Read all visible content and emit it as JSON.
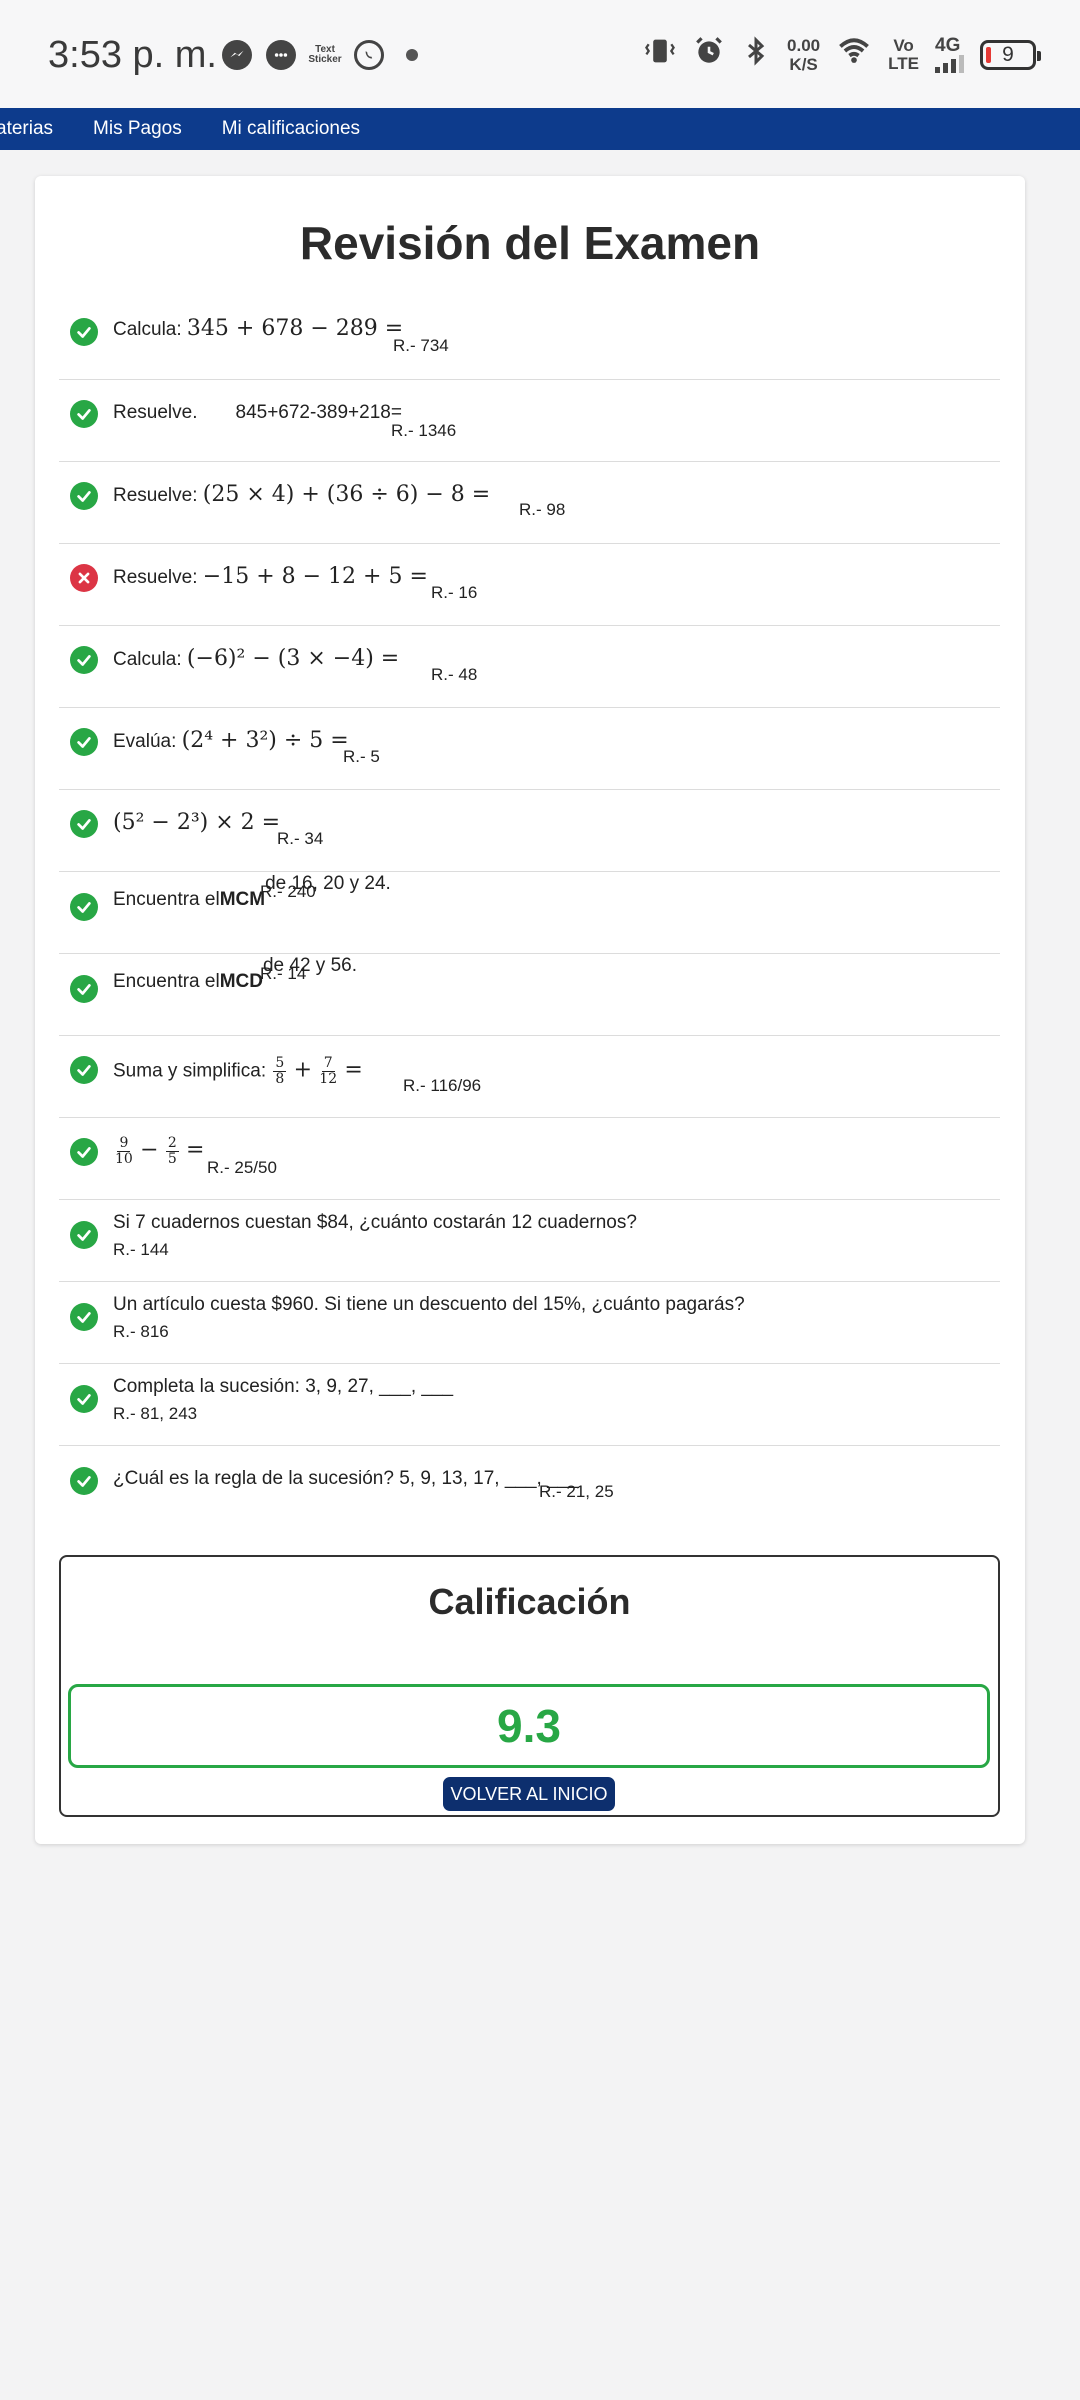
{
  "status_bar": {
    "time": "3:53 p. m.",
    "app_icons": [
      "messenger-icon",
      "chat-icon",
      "text-sticker-icon",
      "whatsapp-icon"
    ],
    "sticker_label": "Text\nSticker",
    "speed_value": "0.00",
    "speed_unit": "K/S",
    "volte_top": "Vo",
    "volte_bottom": "LTE",
    "network": "4G",
    "battery": "9"
  },
  "nav": {
    "items": [
      "aterias",
      "Mis Pagos",
      "Mi calificaciones"
    ]
  },
  "page": {
    "title": "Revisión del Examen"
  },
  "questions": [
    {
      "status": "correct",
      "prefix": "Calcula: ",
      "math": "345 + 678 − 289 =",
      "answer": "R.- 734"
    },
    {
      "status": "correct",
      "prefix": "Resuelve.",
      "math": "845+672-389+218=",
      "answer": "R.- 1346"
    },
    {
      "status": "correct",
      "prefix": "Resuelve: ",
      "math": "(25 × 4) + (36 ÷ 6) − 8 =",
      "answer": "R.- 98"
    },
    {
      "status": "incorrect",
      "prefix": "Resuelve: ",
      "math": "−15 + 8 − 12 + 5 =",
      "answer": "R.- 16"
    },
    {
      "status": "correct",
      "prefix": "Calcula: ",
      "math": "(−6)² − (3 × −4) =",
      "answer": "R.- 48"
    },
    {
      "status": "correct",
      "prefix": "Evalúa: ",
      "math": "(2⁴ + 3²) ÷ 5 =",
      "answer": "R.- 5"
    },
    {
      "status": "correct",
      "prefix": "",
      "math": "(5² − 2³) × 2 =",
      "answer": "R.- 34"
    },
    {
      "status": "correct",
      "prefix": "Encuentra el",
      "bold": "MCM",
      "suffix": "de 16, 20 y 24.",
      "answer": "R.- 240"
    },
    {
      "status": "correct",
      "prefix": "Encuentra el",
      "bold": "MCD",
      "suffix": "de 42 y 56.",
      "answer": "R.- 14"
    },
    {
      "status": "correct",
      "prefix": "Suma y simplifica: ",
      "f1n": "5",
      "f1d": "8",
      "op": "+",
      "f2n": "7",
      "f2d": "12",
      "eq": "=",
      "answer": "R.- 116/96"
    },
    {
      "status": "correct",
      "prefix": "",
      "f1n": "9",
      "f1d": "10",
      "op": "−",
      "f2n": "2",
      "f2d": "5",
      "eq": "=",
      "answer": "R.- 25/50"
    },
    {
      "status": "correct",
      "text": "Si 7 cuadernos cuestan $84, ¿cuánto costarán 12 cuadernos?",
      "answer": "R.- 144"
    },
    {
      "status": "correct",
      "text": "Un artículo cuesta $960. Si tiene un descuento del 15%, ¿cuánto pagarás?",
      "answer": "R.- 816"
    },
    {
      "status": "correct",
      "text": "Completa la sucesión: 3, 9, 27, ___, ___",
      "answer": "R.- 81, 243"
    },
    {
      "status": "correct",
      "text": "¿Cuál es la regla de la sucesión? 5, 9, 13, 17, ___, ___",
      "answer": "R.- 21, 25"
    }
  ],
  "grade": {
    "title": "Calificación",
    "value": "9.3",
    "button": "VOLVER AL INICIO"
  },
  "colors": {
    "nav": "#0d3b8c",
    "correct": "#28a745",
    "incorrect": "#dc3545",
    "button": "#0d2f6e"
  }
}
